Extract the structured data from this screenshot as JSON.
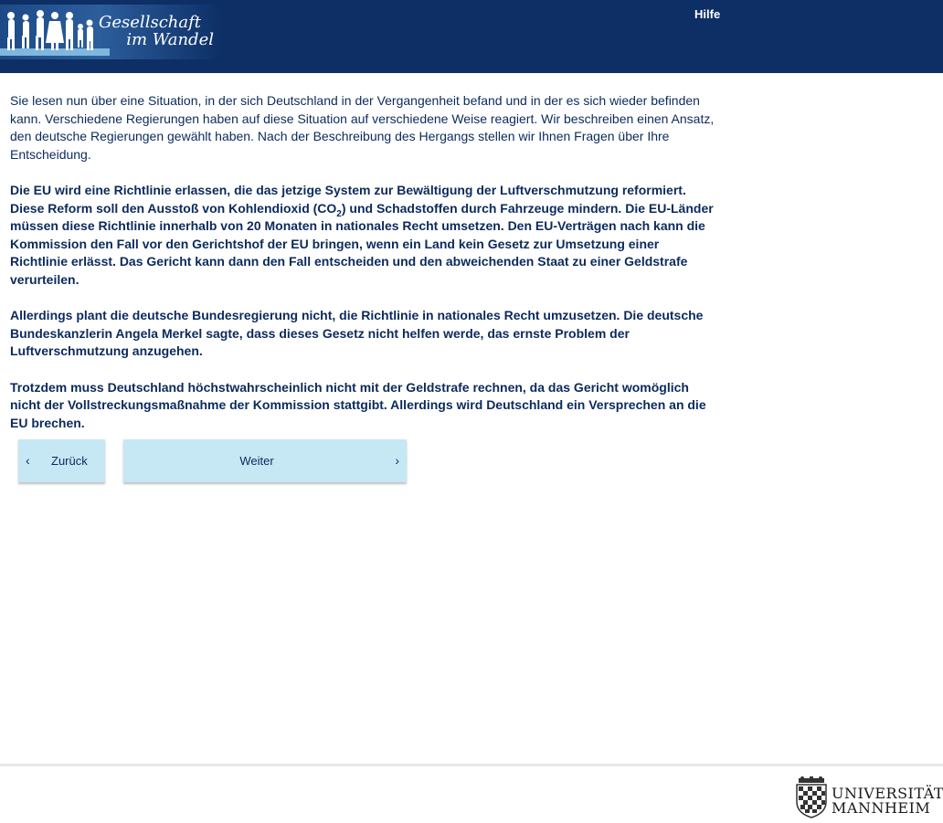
{
  "header": {
    "logo_line1": "Gesellschaft",
    "logo_line2": "im Wandel",
    "help_label": "Hilfe"
  },
  "content": {
    "intro": "Sie lesen nun über eine Situation, in der sich Deutschland in der Vergangenheit befand und in der es sich wieder befinden kann. Verschiedene Regierungen haben auf diese Situation auf verschiedene Weise reagiert. Wir beschreiben einen Ansatz, den deutsche Regierungen gewählt haben. Nach der Beschreibung des Hergangs stellen wir Ihnen Fragen über Ihre Entscheidung.",
    "para1_before": "Die EU wird eine Richtlinie erlassen, die das jetzige System zur Bewältigung der Luftverschmutzung reformiert. Diese Reform soll den Ausstoß von Kohlendioxid (CO",
    "para1_sub": "2",
    "para1_after": ") und Schadstoffen durch Fahrzeuge mindern. Die EU-Länder müssen diese Richtlinie innerhalb von 20 Monaten in nationales Recht umsetzen. Den EU-Verträgen nach kann die Kommission den Fall vor den Gerichtshof der EU bringen, wenn ein Land kein Gesetz zur Umsetzung einer Richtlinie erlässt. Das Gericht kann dann den Fall entscheiden und den abweichenden Staat zu einer Geldstrafe verurteilen.",
    "para2": "Allerdings plant die deutsche Bundesregierung nicht, die Richtlinie in nationales Recht umzusetzen. Die deutsche Bundeskanzlerin Angela Merkel sagte, dass dieses Gesetz nicht helfen werde, das ernste Problem der Luftverschmutzung anzugehen.",
    "para3": "Trotzdem muss Deutschland höchstwahrscheinlich nicht mit der Geldstrafe rechnen, da das Gericht womöglich nicht der Vollstreckungsmaßnahme der Kommission stattgibt. Allerdings wird Deutschland ein Versprechen an die EU brechen."
  },
  "nav": {
    "back_label": "Zurück",
    "next_label": "Weiter",
    "back_chevron": "‹",
    "next_chevron": "›"
  },
  "footer": {
    "uni_line1": "UNIVERSITÄT",
    "uni_line2": "MANNHEIM"
  },
  "colors": {
    "header_bg": "#0d2f66",
    "text": "#0b2a5c",
    "button_bg": "#c6e7f4"
  }
}
